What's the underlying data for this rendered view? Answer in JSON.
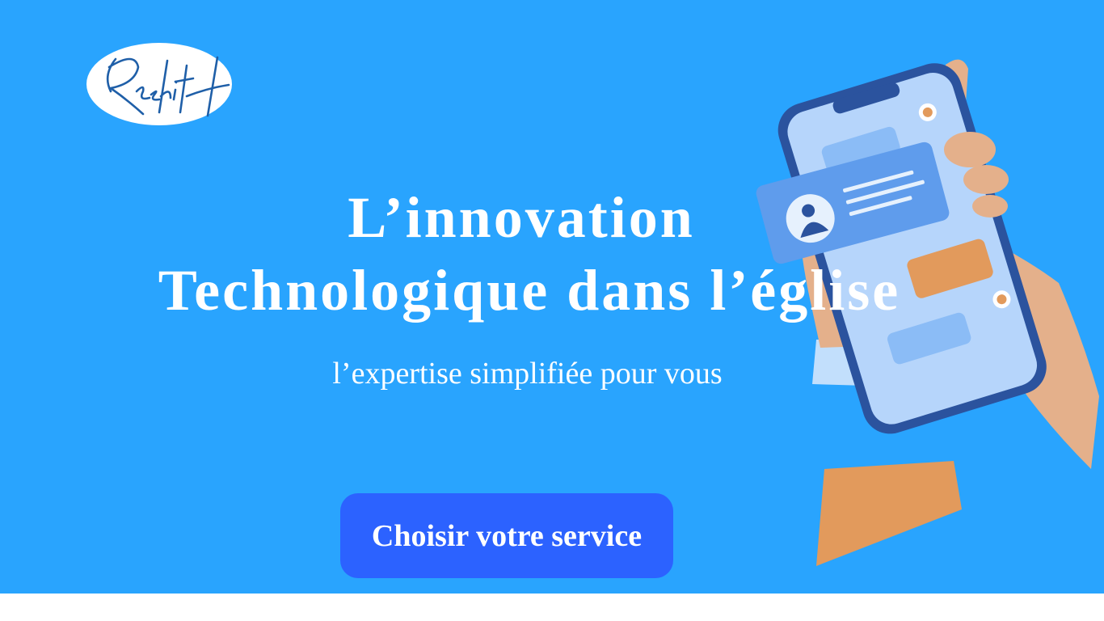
{
  "brand": {
    "logo_text": "ReshitH"
  },
  "hero": {
    "title_line1": "L’innovation",
    "title_line2": "Technologique dans l’église",
    "subtitle": "l’expertise simplifiée pour vous",
    "cta_label": "Choisir votre service",
    "illustration": "hand-holding-phone-chat-illustration"
  },
  "colors": {
    "background": "#29a4fe",
    "button": "#2c62ff",
    "logo_text": "#1f5fa8"
  }
}
